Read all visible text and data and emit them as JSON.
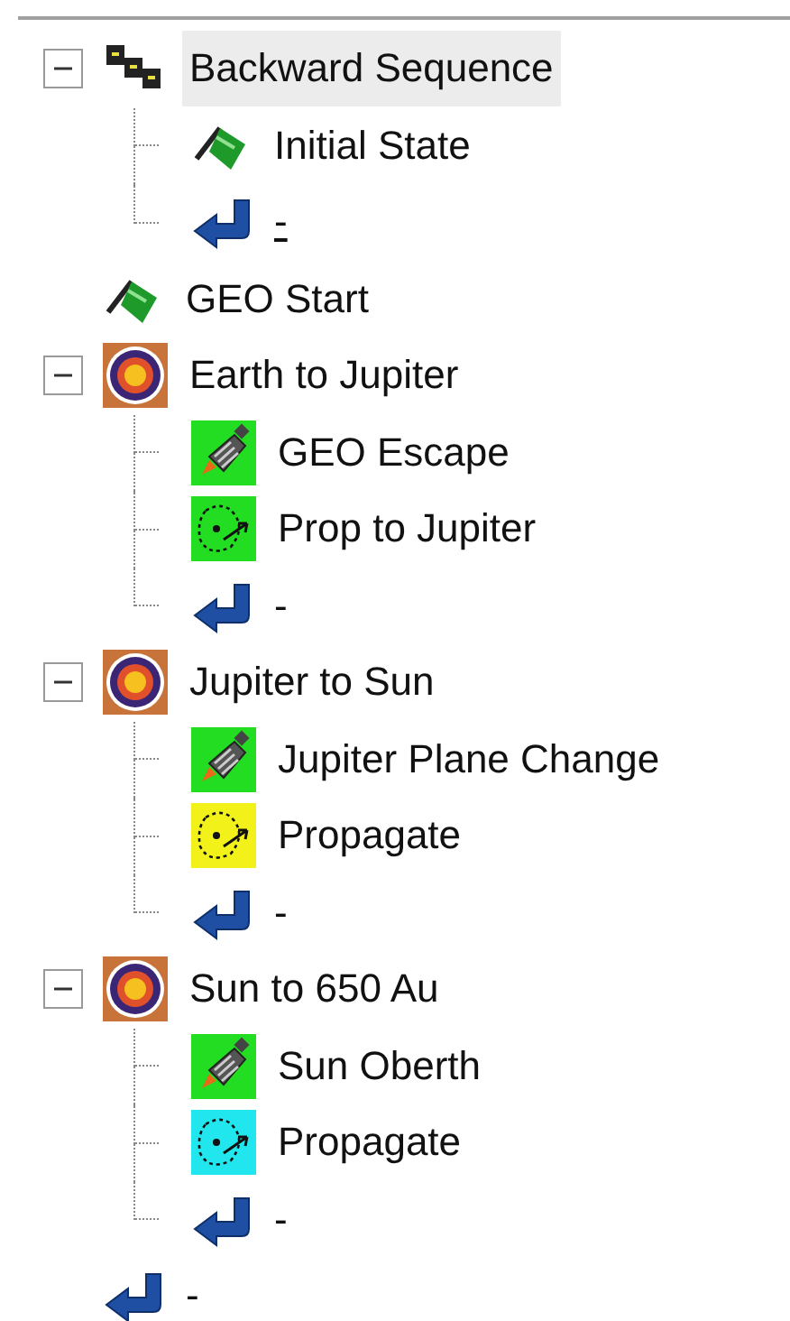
{
  "tree": [
    {
      "kind": "sequence",
      "label": "Backward Sequence",
      "selected": true,
      "expanded": true,
      "underlined": false,
      "children": [
        {
          "kind": "initial_state",
          "label": "Initial State",
          "selected": false,
          "underlined": false
        },
        {
          "kind": "return",
          "label": "-",
          "selected": false,
          "underlined": true
        }
      ]
    },
    {
      "kind": "initial_state",
      "label": "GEO Start",
      "selected": false,
      "underlined": false
    },
    {
      "kind": "target_sequence",
      "label": "Earth to Jupiter",
      "selected": false,
      "expanded": true,
      "underlined": false,
      "children": [
        {
          "kind": "maneuver",
          "label": "GEO Escape",
          "color": "#22dd22",
          "selected": false,
          "underlined": false
        },
        {
          "kind": "propagate",
          "label": "Prop to Jupiter",
          "color": "#22dd22",
          "selected": false,
          "underlined": false
        },
        {
          "kind": "return",
          "label": "-",
          "selected": false,
          "underlined": false
        }
      ]
    },
    {
      "kind": "target_sequence",
      "label": "Jupiter to Sun",
      "selected": false,
      "expanded": true,
      "underlined": false,
      "children": [
        {
          "kind": "maneuver",
          "label": "Jupiter Plane Change",
          "color": "#22dd22",
          "selected": false,
          "underlined": false
        },
        {
          "kind": "propagate",
          "label": "Propagate",
          "color": "#f2f21a",
          "selected": false,
          "underlined": false
        },
        {
          "kind": "return",
          "label": "-",
          "selected": false,
          "underlined": false
        }
      ]
    },
    {
      "kind": "target_sequence",
      "label": "Sun to 650 Au",
      "selected": false,
      "expanded": true,
      "underlined": false,
      "children": [
        {
          "kind": "maneuver",
          "label": "Sun Oberth",
          "color": "#22dd22",
          "selected": false,
          "underlined": false
        },
        {
          "kind": "propagate",
          "label": "Propagate",
          "color": "#22e6ee",
          "selected": false,
          "underlined": false
        },
        {
          "kind": "return",
          "label": "-",
          "selected": false,
          "underlined": false
        }
      ]
    },
    {
      "kind": "return",
      "label": "-",
      "selected": false,
      "underlined": false
    }
  ]
}
